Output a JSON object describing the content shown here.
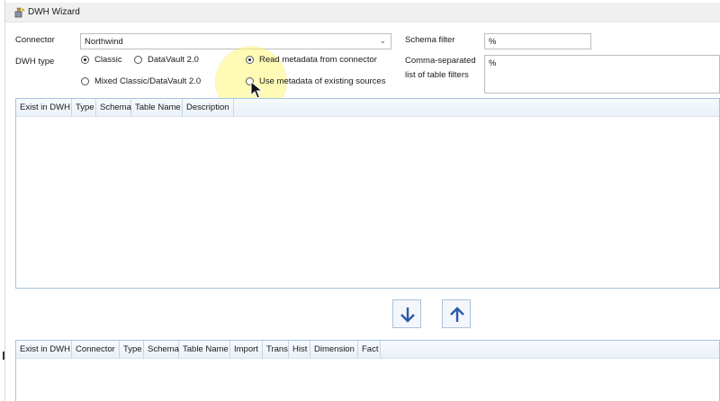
{
  "window": {
    "title": "DWH Wizard"
  },
  "form": {
    "connector_label": "Connector",
    "connector_value": "Northwind",
    "dwh_type_label": "DWH type",
    "dwh_types": [
      {
        "label": "Classic",
        "checked": true
      },
      {
        "label": "DataVault 2.0",
        "checked": false
      },
      {
        "label": "Mixed Classic/DataVault 2.0",
        "checked": false
      }
    ],
    "metadata_options": [
      {
        "label": "Read metadata from connector",
        "checked": true
      },
      {
        "label": "Use metadata of existing sources",
        "checked": false
      }
    ],
    "schema_filter_label": "Schema filter",
    "schema_filter_value": "%",
    "table_filter_label_1": "Comma-separated",
    "table_filter_label_2": "list of table filters",
    "table_filter_value": "%"
  },
  "source_grid": {
    "columns": [
      "Exist in DWH",
      "Type",
      "Schema",
      "Table Name",
      "Description"
    ]
  },
  "target_grid": {
    "columns": [
      "Exist in DWH",
      "Connector",
      "Type",
      "Schema",
      "Table Name",
      "Import",
      "Trans",
      "Hist",
      "Dimension",
      "Fact"
    ]
  },
  "icons": {
    "move_down": "arrow-down-icon",
    "move_up": "arrow-up-icon",
    "app": "wizard-app-icon"
  },
  "colors": {
    "accent": "#2b5aa8",
    "grid_border": "#a9c3df",
    "cursor_highlight": "#fff578"
  }
}
